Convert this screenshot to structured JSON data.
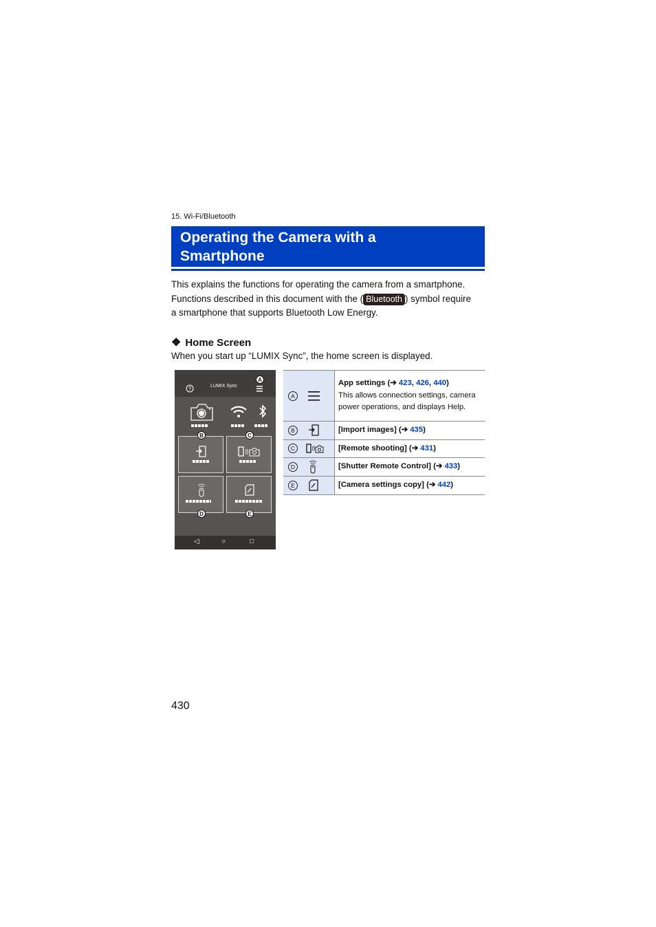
{
  "chapter": "15. Wi-Fi/Bluetooth",
  "title_line1": "Operating the Camera with a",
  "title_line2": "Smartphone",
  "intro": {
    "line1": "This explains the functions for operating the camera from a smartphone.",
    "line2_pre": "Functions described in this document with the (",
    "badge": "Bluetooth",
    "line2_post": ") symbol require",
    "line3": "a smartphone that supports Bluetooth Low Energy."
  },
  "section": {
    "bullet": "❖",
    "heading": "Home Screen",
    "text": "When you start up “LUMIX Sync”, the home screen is displayed."
  },
  "phone": {
    "app_title": "LUMIX Sync",
    "help_glyph": "?",
    "markers": [
      "A",
      "B",
      "C",
      "D",
      "E"
    ],
    "nav": [
      "◁",
      "○",
      "□"
    ]
  },
  "table": {
    "rows": [
      {
        "label": "A",
        "title": "App settings (➔ ",
        "links": [
          "423",
          "426",
          "440"
        ],
        "desc": "This allows connection settings, camera power operations, and displays Help.",
        "icon": "menu-icon"
      },
      {
        "label": "B",
        "title": "[Import images] (➔ ",
        "links": [
          "435"
        ],
        "icon": "import-icon"
      },
      {
        "label": "C",
        "title": "[Remote shooting] (➔ ",
        "links": [
          "431"
        ],
        "icon": "remote-shooting-icon"
      },
      {
        "label": "D",
        "title": "[Shutter Remote Control] (➔ ",
        "links": [
          "433"
        ],
        "icon": "shutter-remote-icon"
      },
      {
        "label": "E",
        "title": "[Camera settings copy] (➔ ",
        "links": [
          "442"
        ],
        "icon": "settings-copy-icon"
      }
    ]
  },
  "page_number": "430"
}
